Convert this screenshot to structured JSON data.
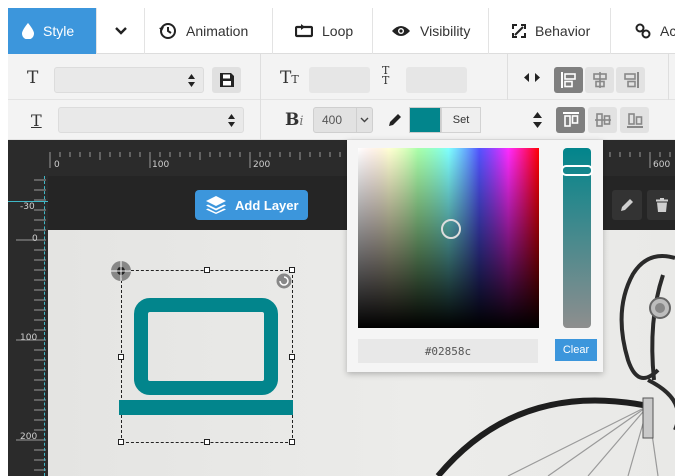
{
  "tabs": [
    {
      "label": "Style",
      "icon": "droplet-icon",
      "active": true
    },
    {
      "label": "",
      "icon": "chevron-down-icon"
    },
    {
      "label": "Animation",
      "icon": "history-icon"
    },
    {
      "label": "Loop",
      "icon": "loop-icon"
    },
    {
      "label": "Visibility",
      "icon": "eye-icon"
    },
    {
      "label": "Behavior",
      "icon": "expand-icon"
    },
    {
      "label": "Act",
      "icon": "link-icon"
    }
  ],
  "toolbar1": {
    "font_family_select": "",
    "font_size_value": "",
    "line_height_value": "",
    "icons": [
      "text-icon",
      "save-icon",
      "font-size-icon",
      "line-height-icon",
      "horizontal-arrows-icon",
      "align-left-icon",
      "align-center-icon",
      "align-right-icon"
    ]
  },
  "toolbar2": {
    "font_select": "",
    "font_weight": "400",
    "color_set_label": "Set",
    "icons": [
      "text-format-icon",
      "bold-italic-icon",
      "pencil-icon",
      "vertical-arrows-icon",
      "align-top-icon",
      "align-middle-icon",
      "align-bottom-icon"
    ]
  },
  "rulers": {
    "top_labels": [
      "0",
      "100",
      "200",
      "600"
    ],
    "left_labels": [
      "-30",
      "0",
      "100",
      "200"
    ]
  },
  "canvas": {
    "add_layer_label": "Add Layer",
    "layer_icon": "laptop-icon"
  },
  "color_picker": {
    "hex_value": "#02858c",
    "clear_label": "Clear",
    "selected_color": "#02858c",
    "accent": "#3c96dc"
  }
}
